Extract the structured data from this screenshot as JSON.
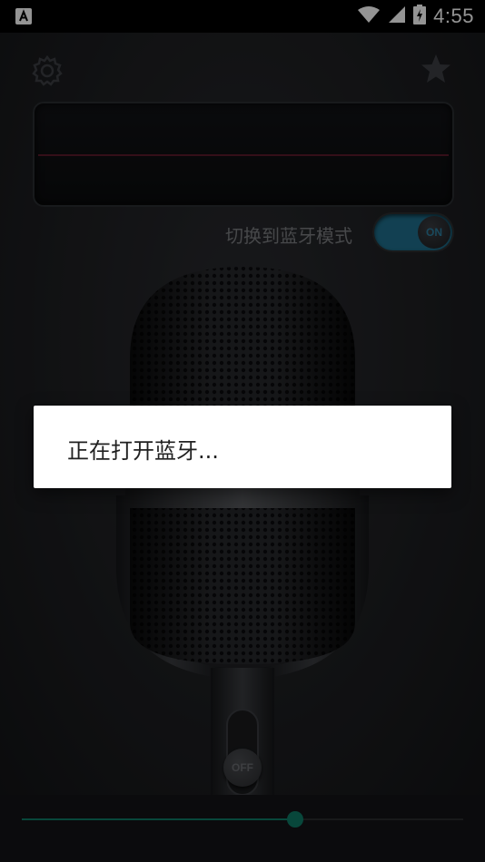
{
  "status_bar": {
    "time": "4:55",
    "icons": [
      "notification-icon",
      "wifi-icon",
      "signal-icon",
      "battery-icon"
    ]
  },
  "header": {
    "settings_icon": "gear-icon",
    "favorite_icon": "star-icon"
  },
  "bluetooth_mode": {
    "label": "切换到蓝牙模式",
    "toggle_text": "ON",
    "toggle_on": true,
    "accent_color": "#1f6f8d"
  },
  "mic_switch": {
    "text": "OFF"
  },
  "dialog": {
    "message": "正在打开蓝牙..."
  },
  "volume_slider": {
    "value": 0.62,
    "color": "#0f7a66"
  }
}
